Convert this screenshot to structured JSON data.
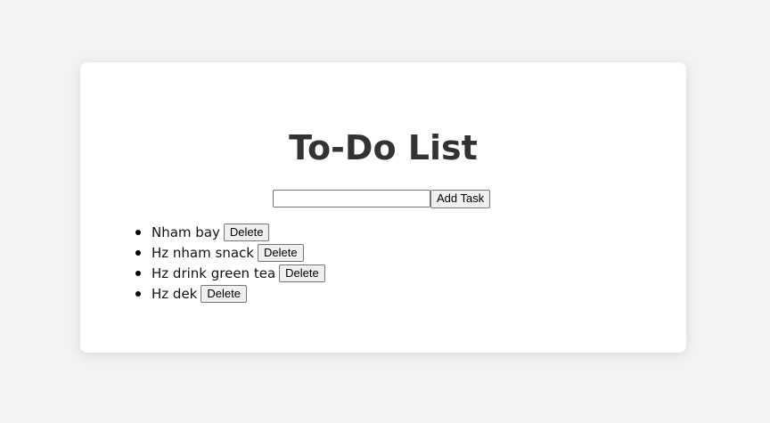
{
  "app": {
    "title": "To-Do List"
  },
  "form": {
    "input_value": "",
    "input_placeholder": "",
    "add_label": "Add Task"
  },
  "tasks": [
    {
      "text": "Nham bay",
      "delete_label": "Delete"
    },
    {
      "text": "Hz nham snack",
      "delete_label": "Delete"
    },
    {
      "text": "Hz drink green tea",
      "delete_label": "Delete"
    },
    {
      "text": "Hz dek",
      "delete_label": "Delete"
    }
  ],
  "colors": {
    "page_background": "#f3f3f3",
    "card_background": "#ffffff",
    "title_text": "#333333"
  }
}
